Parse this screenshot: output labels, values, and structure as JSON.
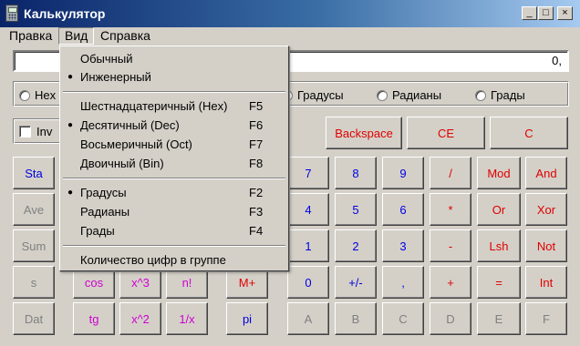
{
  "window": {
    "title": "Калькулятор"
  },
  "titlebar_buttons": {
    "minimize": "_",
    "maximize": "□",
    "close": "×"
  },
  "menubar": {
    "edit": "Правка",
    "view": "Вид",
    "help": "Справка"
  },
  "display": {
    "value": "0,"
  },
  "number_system": {
    "hex": "Hex"
  },
  "angle_units": {
    "degrees": "Градусы",
    "radians": "Радианы",
    "grads": "Грады"
  },
  "controls": {
    "inv": "Inv",
    "backspace": "Backspace",
    "ce": "CE",
    "c": "C"
  },
  "left_column": {
    "sta": "Sta",
    "ave": "Ave",
    "sum": "Sum",
    "s": "s",
    "dat": "Dat"
  },
  "func": {
    "cos": "cos",
    "x3": "x^3",
    "nfact": "n!",
    "mplus": "M+",
    "tg": "tg",
    "x2": "x^2",
    "inv_x": "1/x",
    "pi": "pi"
  },
  "digits": {
    "d7": "7",
    "d8": "8",
    "d9": "9",
    "d4": "4",
    "d5": "5",
    "d6": "6",
    "d1": "1",
    "d2": "2",
    "d3": "3",
    "d0": "0",
    "sign": "+/-",
    "dot": ",",
    "A": "A",
    "B": "B",
    "C": "C",
    "D": "D",
    "E": "E",
    "F": "F"
  },
  "ops": {
    "div": "/",
    "mul": "*",
    "sub": "-",
    "add": "+",
    "eq": "=",
    "mod": "Mod",
    "and": "And",
    "or": "Or",
    "xor": "Xor",
    "lsh": "Lsh",
    "not": "Not",
    "int": "Int"
  },
  "view_menu": {
    "standard": "Обычный",
    "scientific": "Инженерный",
    "hex": {
      "label": "Шестнадцатеричный (Hex)",
      "shortcut": "F5"
    },
    "dec": {
      "label": "Десятичный (Dec)",
      "shortcut": "F6"
    },
    "oct": {
      "label": "Восьмеричный (Oct)",
      "shortcut": "F7"
    },
    "bin": {
      "label": "Двоичный (Bin)",
      "shortcut": "F8"
    },
    "degrees": {
      "label": "Градусы",
      "shortcut": "F2"
    },
    "radians": {
      "label": "Радианы",
      "shortcut": "F3"
    },
    "grads": {
      "label": "Грады",
      "shortcut": "F4"
    },
    "digit_grouping": "Количество цифр в группе",
    "bullet": "●"
  },
  "colors": {
    "red": "#e00000",
    "blue": "#0000e0",
    "magenta": "#d000d0",
    "gray": "#808080",
    "face": "#d4d0c8"
  }
}
